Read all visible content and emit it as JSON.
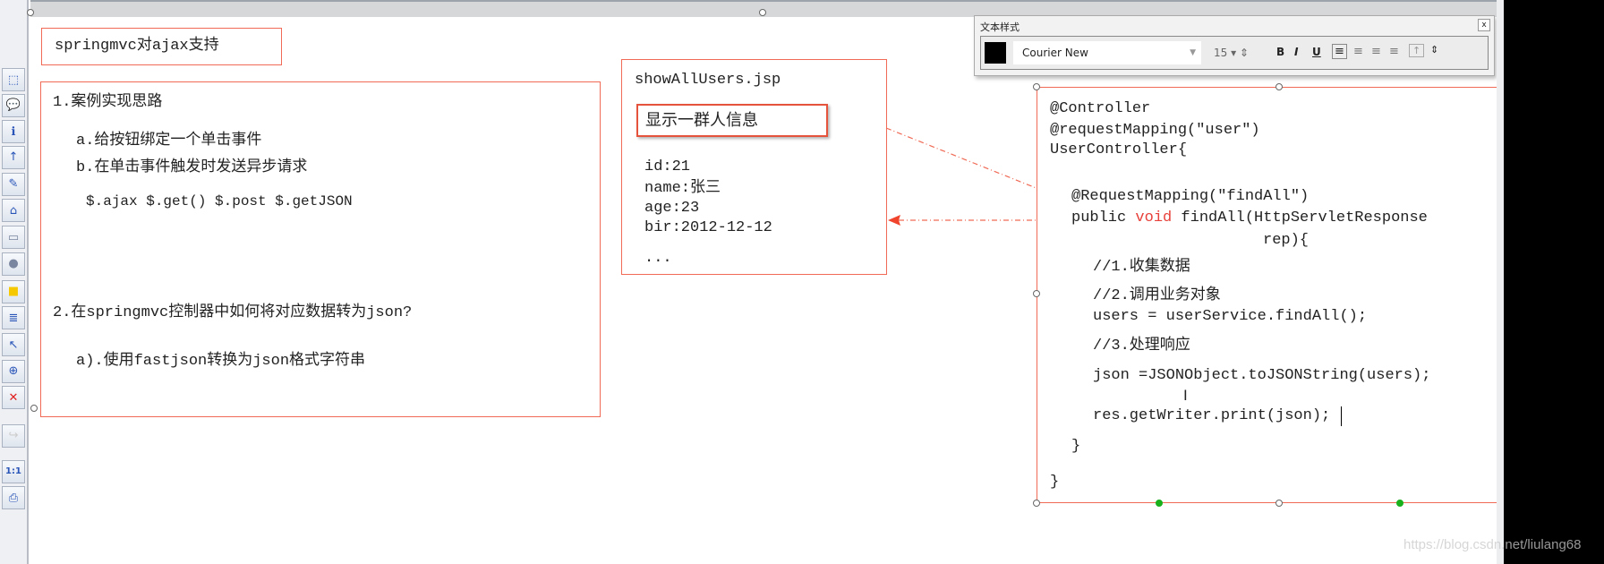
{
  "toolbar": {
    "icons": [
      "select-rect-icon",
      "comment-icon",
      "info-icon",
      "up-arrow-icon",
      "eraser-icon",
      "path-icon",
      "rectangle-icon",
      "circle-icon",
      "yellow-note-icon",
      "text-icon",
      "pointer-add-icon",
      "add-point-icon",
      "delete-icon",
      "redo-icon",
      "actual-size-icon",
      "print-icon"
    ],
    "actual_size_label": "1:1"
  },
  "title_box": {
    "text": "springmvc对ajax支持"
  },
  "box1": {
    "h1": "1.案例实现思路",
    "a": "a.给按钮绑定一个单击事件",
    "b": "b.在单击事件触发时发送异步请求",
    "methods": "$.ajax $.get() $.post $.getJSON",
    "h2": "2.在springmvc控制器中如何将对应数据转为json?",
    "a2": "a).使用fastjson转换为json格式字符串"
  },
  "box2": {
    "file": "showAllUsers.jsp",
    "button": "显示一群人信息",
    "lines": [
      "id:21",
      "name:张三",
      "age:23",
      "bir:2012-12-12",
      "..."
    ]
  },
  "code": {
    "l1": "@Controller",
    "l2": "@requestMapping(\"user\")",
    "l3": "UserController{",
    "l4": "@RequestMapping(\"findAll\")",
    "l5a": "public ",
    "l5b": "void",
    "l5c": " findAll(HttpServletResponse",
    "l6": "rep){",
    "l7": "//1.收集数据",
    "l8": "//2.调用业务对象",
    "l9": "users = userService.findAll();",
    "l10": "//3.处理响应",
    "l11": "json =JSONObject.toJSONString(users);",
    "l12": "res.getWriter.print(json);",
    "l13": "}",
    "l14": "}"
  },
  "style_panel": {
    "title": "文本样式",
    "font": "Courier New",
    "size": "15",
    "color": "#000000",
    "bold": "B",
    "italic": "I",
    "underline": "U",
    "close": "x"
  },
  "watermark": "https://blog.csdn.net/liulang68",
  "colors": {
    "box_border": "#f06a55",
    "keyword": "#e8403a"
  }
}
